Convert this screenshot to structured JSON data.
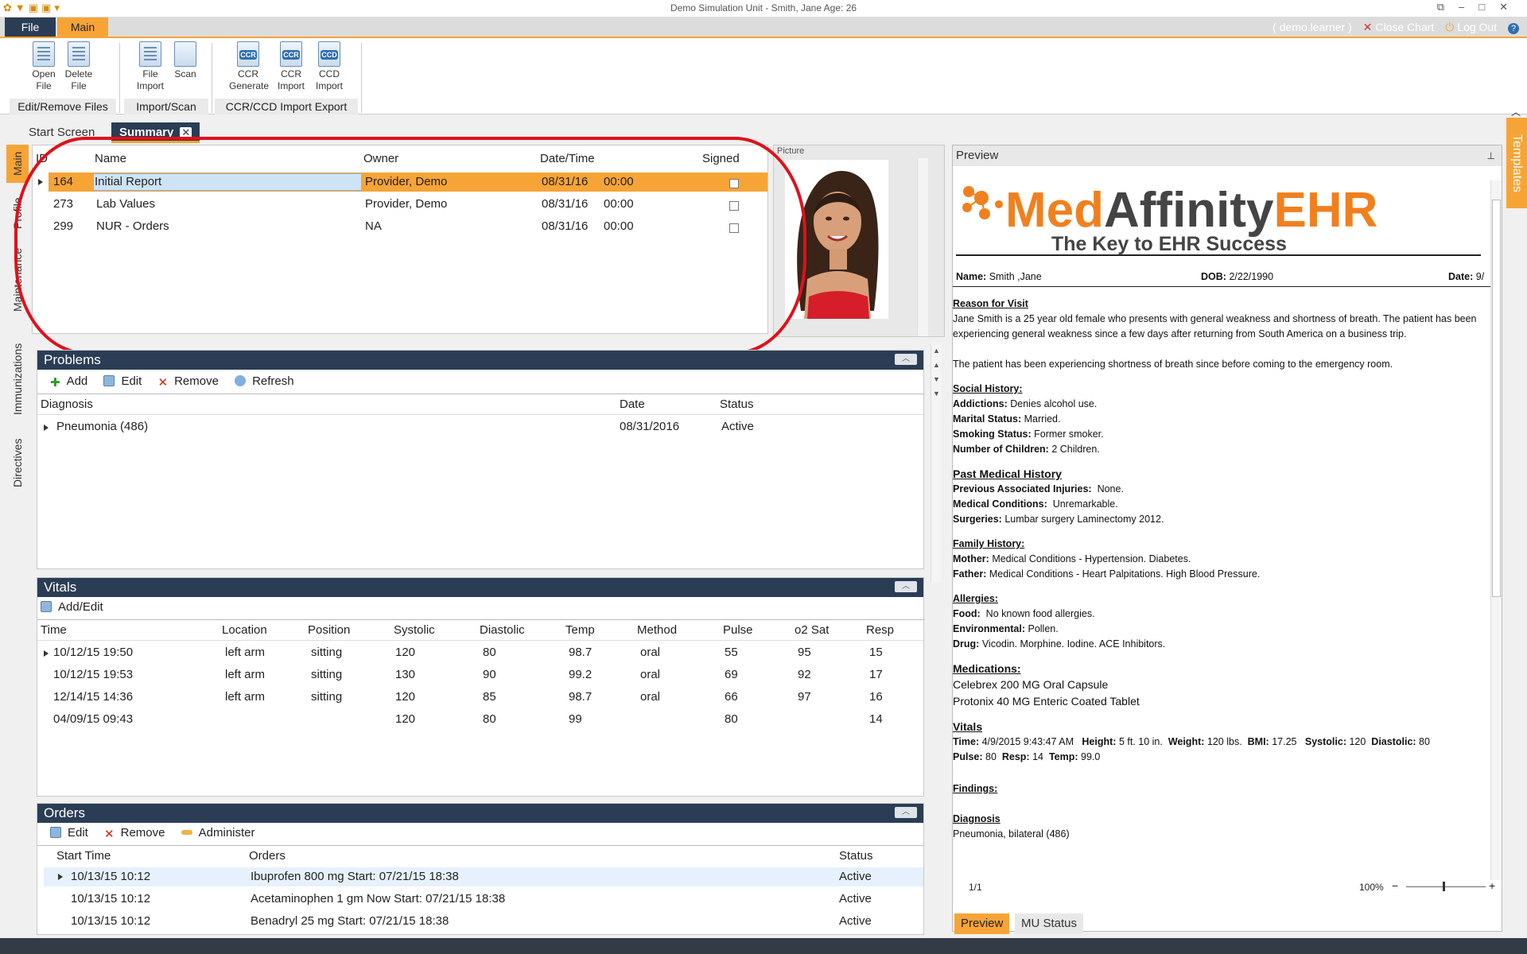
{
  "window": {
    "title": "Demo Simulation Unit - Smith, Jane Age: 26"
  },
  "ribbon_tabs": {
    "file": "File",
    "main": "Main"
  },
  "user_bar": {
    "user": "( demo.learner )",
    "close_chart": "Close Chart",
    "log_out": "Log Out"
  },
  "ribbon": {
    "open_file": "Open File",
    "delete_file": "Delete File",
    "file_import": "File Import",
    "scan": "Scan",
    "ccr_generate": "CCR Generate",
    "ccr_import": "CCR Import",
    "ccd_import": "CCD Import",
    "ccr_icon": "CCR",
    "ccd_icon": "CCD",
    "groups": {
      "edit_remove": "Edit/Remove Files",
      "import_scan": "Import/Scan",
      "ccr_ccd": "CCR/CCD  Import Export"
    }
  },
  "doc_tabs": {
    "start": "Start Screen",
    "summary": "Summary",
    "close": "✕"
  },
  "side_nav": {
    "main": "Main",
    "profile": "Profile",
    "maintenance": "Maintenance",
    "immunizations": "Immunizations",
    "directives": "Directives"
  },
  "templates_tab": "Templates",
  "documents": {
    "headers": {
      "id": "ID",
      "name": "Name",
      "owner": "Owner",
      "datetime": "Date/Time",
      "signed": "Signed"
    },
    "rows": [
      {
        "id": "164",
        "name": "Initial Report",
        "owner": "Provider, Demo",
        "date": "08/31/16",
        "time": "00:00"
      },
      {
        "id": "273",
        "name": "Lab Values",
        "owner": "Provider, Demo",
        "date": "08/31/16",
        "time": "00:00"
      },
      {
        "id": "299",
        "name": "NUR - Orders",
        "owner": "NA",
        "date": "08/31/16",
        "time": "00:00"
      }
    ]
  },
  "picture": {
    "label": "Picture"
  },
  "problems": {
    "title": "Problems",
    "toolbar": {
      "add": "Add",
      "edit": "Edit",
      "remove": "Remove",
      "refresh": "Refresh"
    },
    "headers": {
      "diagnosis": "Diagnosis",
      "date": "Date",
      "status": "Status"
    },
    "rows": [
      {
        "diagnosis": "Pneumonia (486)",
        "date": "08/31/2016",
        "status": "Active"
      }
    ]
  },
  "vitals": {
    "title": "Vitals",
    "toolbar": {
      "add_edit": "Add/Edit"
    },
    "headers": {
      "time": "Time",
      "location": "Location",
      "position": "Position",
      "systolic": "Systolic",
      "diastolic": "Diastolic",
      "temp": "Temp",
      "method": "Method",
      "pulse": "Pulse",
      "o2": "o2 Sat",
      "resp": "Resp"
    },
    "rows": [
      {
        "time": "10/12/15 19:50",
        "location": "left arm",
        "position": "sitting",
        "systolic": "120",
        "diastolic": "80",
        "temp": "98.7",
        "method": "oral",
        "pulse": "55",
        "o2": "95",
        "resp": "15"
      },
      {
        "time": "10/12/15 19:53",
        "location": "left arm",
        "position": "sitting",
        "systolic": "130",
        "diastolic": "90",
        "temp": "99.2",
        "method": "oral",
        "pulse": "69",
        "o2": "92",
        "resp": "17"
      },
      {
        "time": "12/14/15 14:36",
        "location": "left arm",
        "position": "sitting",
        "systolic": "120",
        "diastolic": "85",
        "temp": "98.7",
        "method": "oral",
        "pulse": "66",
        "o2": "97",
        "resp": "16"
      },
      {
        "time": "04/09/15 09:43",
        "location": "",
        "position": "",
        "systolic": "120",
        "diastolic": "80",
        "temp": "99",
        "method": "",
        "pulse": "80",
        "o2": "",
        "resp": "14"
      }
    ]
  },
  "orders": {
    "title": "Orders",
    "toolbar": {
      "edit": "Edit",
      "remove": "Remove",
      "administer": "Administer"
    },
    "headers": {
      "start": "Start Time",
      "orders": "Orders",
      "status": "Status"
    },
    "rows": [
      {
        "start": "10/13/15 10:12",
        "order": "Ibuprofen  800 mg   Start: 07/21/15 18:38",
        "status": "Active"
      },
      {
        "start": "10/13/15 10:12",
        "order": "Acetaminophen 1 gm  Now   Start: 07/21/15 18:38",
        "status": "Active"
      },
      {
        "start": "10/13/15 10:12",
        "order": "Benadryl 25 mg   Start: 07/21/15 18:38",
        "status": "Active"
      }
    ]
  },
  "preview": {
    "title": "Preview",
    "logo": {
      "med": "Med",
      "affinity": "Affinity",
      "ehr": "EHR",
      "tagline": "The Key to EHR Success"
    },
    "name_label": "Name:",
    "name": "Smith ,Jane",
    "dob_label": "DOB:",
    "dob": "2/22/1990",
    "date_label": "Date:",
    "date": "9/",
    "reason_h": "Reason for Visit",
    "reason_1": "Jane Smith is a 25 year old female who presents with general weakness and shortness of breath. The patient has been experiencing general weakness since a few days after returning from South America on a business trip.",
    "reason_2": "The patient has been experiencing shortness of breath since before coming to the emergency room.",
    "social_h": "Social History:",
    "addictions_l": "Addictions:",
    "addictions": "Denies alcohol use.",
    "marital_l": "Marital Status:",
    "marital": "Married.",
    "smoking_l": "Smoking Status:",
    "smoking": "Former smoker.",
    "children_l": "Number of Children:",
    "children": "2 Children.",
    "pmh_h": "Past Medical History",
    "injuries_l": "Previous Associated Injuries:",
    "injuries": "None.",
    "conditions_l": "Medical Conditions:",
    "conditions": "Unremarkable.",
    "surgeries_l": "Surgeries:",
    "surgeries": "Lumbar surgery Laminectomy 2012.",
    "family_h": "Family History:",
    "mother_l": "Mother:",
    "mother": "Medical Conditions - Hypertension. Diabetes.",
    "father_l": "Father:",
    "father": "Medical Conditions - Heart Palpitations. High Blood Pressure.",
    "allergies_h": "Allergies:",
    "food_l": "Food:",
    "food": "No known food allergies.",
    "env_l": "Environmental:",
    "env": "Pollen.",
    "drug_l": "Drug:",
    "drug": "Vicodin. Morphine. Iodine. ACE Inhibitors.",
    "meds_h": "Medications:",
    "med_1": "Celebrex 200 MG Oral Capsule",
    "med_2": "Protonix 40 MG Enteric Coated Tablet",
    "vitals_h": "Vitals",
    "v_time_l": "Time:",
    "v_time": "4/9/2015 9:43:47 AM",
    "v_height_l": "Height:",
    "v_height": "5 ft. 10 in.",
    "v_weight_l": "Weight:",
    "v_weight": "120 lbs.",
    "v_bmi_l": "BMI:",
    "v_bmi": "17.25",
    "v_sys_l": "Systolic:",
    "v_sys": "120",
    "v_dia_l": "Diastolic:",
    "v_dia": "80",
    "v_pulse_l": "Pulse:",
    "v_pulse": "80",
    "v_resp_l": "Resp:",
    "v_resp": "14",
    "v_temp_l": "Temp:",
    "v_temp": "99.0",
    "findings_h": "Findings:",
    "diagnosis_h": "Diagnosis",
    "diagnosis": "Pneumonia, bilateral (486)",
    "page": "1/1",
    "zoom": "100%",
    "tab_preview": "Preview",
    "tab_mu": "MU Status"
  },
  "colors": {
    "accent": "#f7a437",
    "navy": "#2b3d55",
    "highlight": "#e0101a"
  }
}
